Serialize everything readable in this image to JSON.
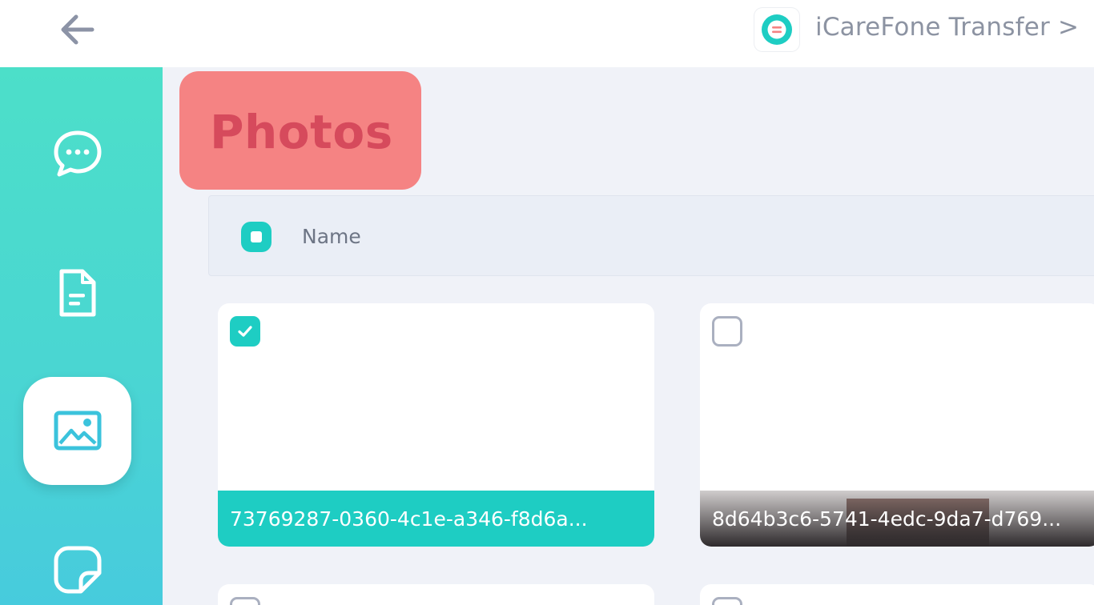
{
  "header": {
    "back_icon": "arrow-left-icon",
    "app_logo_icon": "icarefone-logo-icon",
    "app_title": "iCareFone Transfer >"
  },
  "sidebar": {
    "items": [
      {
        "icon": "chat-bubble-icon",
        "active": false
      },
      {
        "icon": "document-icon",
        "active": false
      },
      {
        "icon": "image-icon",
        "active": true
      },
      {
        "icon": "sticker-icon",
        "active": false
      }
    ]
  },
  "main": {
    "page_title": "Photos",
    "list_header": {
      "column_name": "Name",
      "select_all_state": "partial"
    },
    "photos": [
      {
        "name": "73769287-0360-4c1e-a346-f8d6a...",
        "checked": true
      },
      {
        "name": "8d64b3c6-5741-4edc-9da7-d769...",
        "checked": false
      },
      {
        "name": "",
        "checked": false
      },
      {
        "name": "",
        "checked": false
      }
    ]
  },
  "colors": {
    "accent": "#1ecdc3",
    "sidebar_top": "#4cdfc9",
    "sidebar_bottom": "#47cbdd",
    "title_highlight": "#f58383",
    "title_text": "#d64a5c"
  }
}
